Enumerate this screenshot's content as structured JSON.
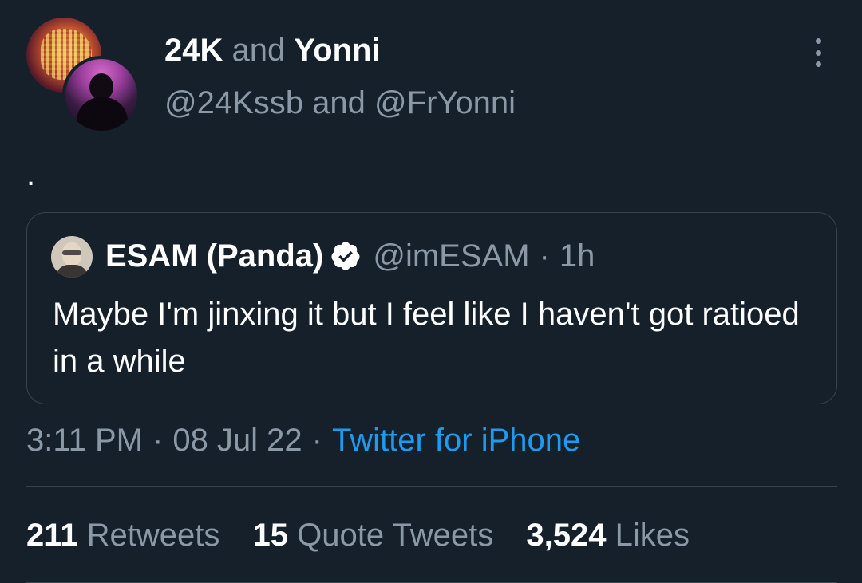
{
  "author": {
    "name1": "24K",
    "connector": "and",
    "name2": "Yonni",
    "handle1": "@24Kssb",
    "handle_connector": "and",
    "handle2": "@FrYonni"
  },
  "tweet": {
    "text": "."
  },
  "quoted": {
    "name": "ESAM (Panda)",
    "verified": true,
    "handle": "@imESAM",
    "separator": "·",
    "time": "1h",
    "text": "Maybe I'm jinxing it but I feel like I haven't got ratioed in a while"
  },
  "meta": {
    "time": "3:11 PM",
    "separator": "·",
    "date": "08 Jul 22",
    "separator2": "·",
    "source": "Twitter for iPhone"
  },
  "stats": {
    "retweets_count": "211",
    "retweets_label": "Retweets",
    "quotes_count": "15",
    "quotes_label": "Quote Tweets",
    "likes_count": "3,524",
    "likes_label": "Likes"
  },
  "icons": {
    "more": "more-vertical-icon",
    "verified": "verified-badge-icon"
  },
  "colors": {
    "background": "#15202b",
    "secondary_text": "#8b98a5",
    "accent": "#1d9bf0",
    "border": "#38444d"
  }
}
